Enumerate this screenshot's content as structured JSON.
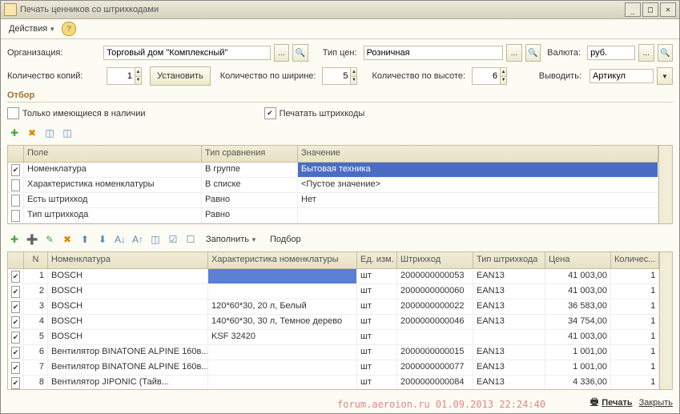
{
  "window": {
    "title": "Печать ценников со штрихкодами"
  },
  "menu": {
    "actions": "Действия"
  },
  "form": {
    "org_label": "Организация:",
    "org_value": "Торговый дом \"Комплексный\"",
    "price_type_label": "Тип цен:",
    "price_type_value": "Розничная",
    "currency_label": "Валюта:",
    "currency_value": "руб.",
    "copies_label": "Количество копий:",
    "copies_value": "1",
    "set_btn": "Установить",
    "width_label": "Количество по ширине:",
    "width_value": "5",
    "height_label": "Количество по высоте:",
    "height_value": "6",
    "output_label": "Выводить:",
    "output_value": "Артикул"
  },
  "filter": {
    "header": "Отбор",
    "only_in_stock": "Только имеющиеся в наличии",
    "print_barcodes": "Печатать штрихкоды",
    "cols": {
      "field": "Поле",
      "cmp": "Тип сравнения",
      "val": "Значение"
    },
    "rows": [
      {
        "checked": true,
        "field": "Номенклатура",
        "cmp": "В группе",
        "val": "Бытовая техника",
        "sel": true
      },
      {
        "checked": false,
        "field": "Характеристика номенклатуры",
        "cmp": "В списке",
        "val": "<Пустое значение>"
      },
      {
        "checked": false,
        "field": "Есть штрихкод",
        "cmp": "Равно",
        "val": "Нет"
      },
      {
        "checked": false,
        "field": "Тип штрихкода",
        "cmp": "Равно",
        "val": ""
      }
    ]
  },
  "nom_toolbar": {
    "fill": "Заполнить",
    "pick": "Подбор"
  },
  "nomgrid": {
    "cols": {
      "n": "N",
      "nom": "Номенклатура",
      "char": "Характеристика номенклатуры",
      "unit": "Ед. изм.",
      "barcode": "Штрихкод",
      "bctype": "Тип штрихкода",
      "price": "Цена",
      "qty": "Количес..."
    },
    "rows": [
      {
        "n": "1",
        "nom": "BOSCH",
        "char": "",
        "unit": "шт",
        "barcode": "2000000000053",
        "bctype": "EAN13",
        "price": "41 003,00",
        "qty": "1",
        "focus": true
      },
      {
        "n": "2",
        "nom": "BOSCH",
        "char": "",
        "unit": "шт",
        "barcode": "2000000000060",
        "bctype": "EAN13",
        "price": "41 003,00",
        "qty": "1"
      },
      {
        "n": "3",
        "nom": "BOSCH",
        "char": "120*60*30, 20 л, Белый",
        "unit": "шт",
        "barcode": "2000000000022",
        "bctype": "EAN13",
        "price": "36 583,00",
        "qty": "1"
      },
      {
        "n": "4",
        "nom": "BOSCH",
        "char": "140*60*30, 30 л, Темное дерево",
        "unit": "шт",
        "barcode": "2000000000046",
        "bctype": "EAN13",
        "price": "34 754,00",
        "qty": "1"
      },
      {
        "n": "5",
        "nom": "BOSCH",
        "char": "KSF 32420",
        "unit": "шт",
        "barcode": "",
        "bctype": "",
        "price": "41 003,00",
        "qty": "1"
      },
      {
        "n": "6",
        "nom": "Вентилятор BINATONE ALPINE 160в...",
        "char": "",
        "unit": "шт",
        "barcode": "2000000000015",
        "bctype": "EAN13",
        "price": "1 001,00",
        "qty": "1"
      },
      {
        "n": "7",
        "nom": "Вентилятор BINATONE ALPINE 160в...",
        "char": "",
        "unit": "шт",
        "barcode": "2000000000077",
        "bctype": "EAN13",
        "price": "1 001,00",
        "qty": "1"
      },
      {
        "n": "8",
        "nom": "Вентилятор JIPONIC (Тайв...",
        "char": "",
        "unit": "шт",
        "barcode": "2000000000084",
        "bctype": "EAN13",
        "price": "4 336,00",
        "qty": "1"
      }
    ]
  },
  "footer": {
    "print": "Печать",
    "close": "Закрыть"
  },
  "watermark": "forum.aeroion.ru 01.09.2013 22:24:40"
}
